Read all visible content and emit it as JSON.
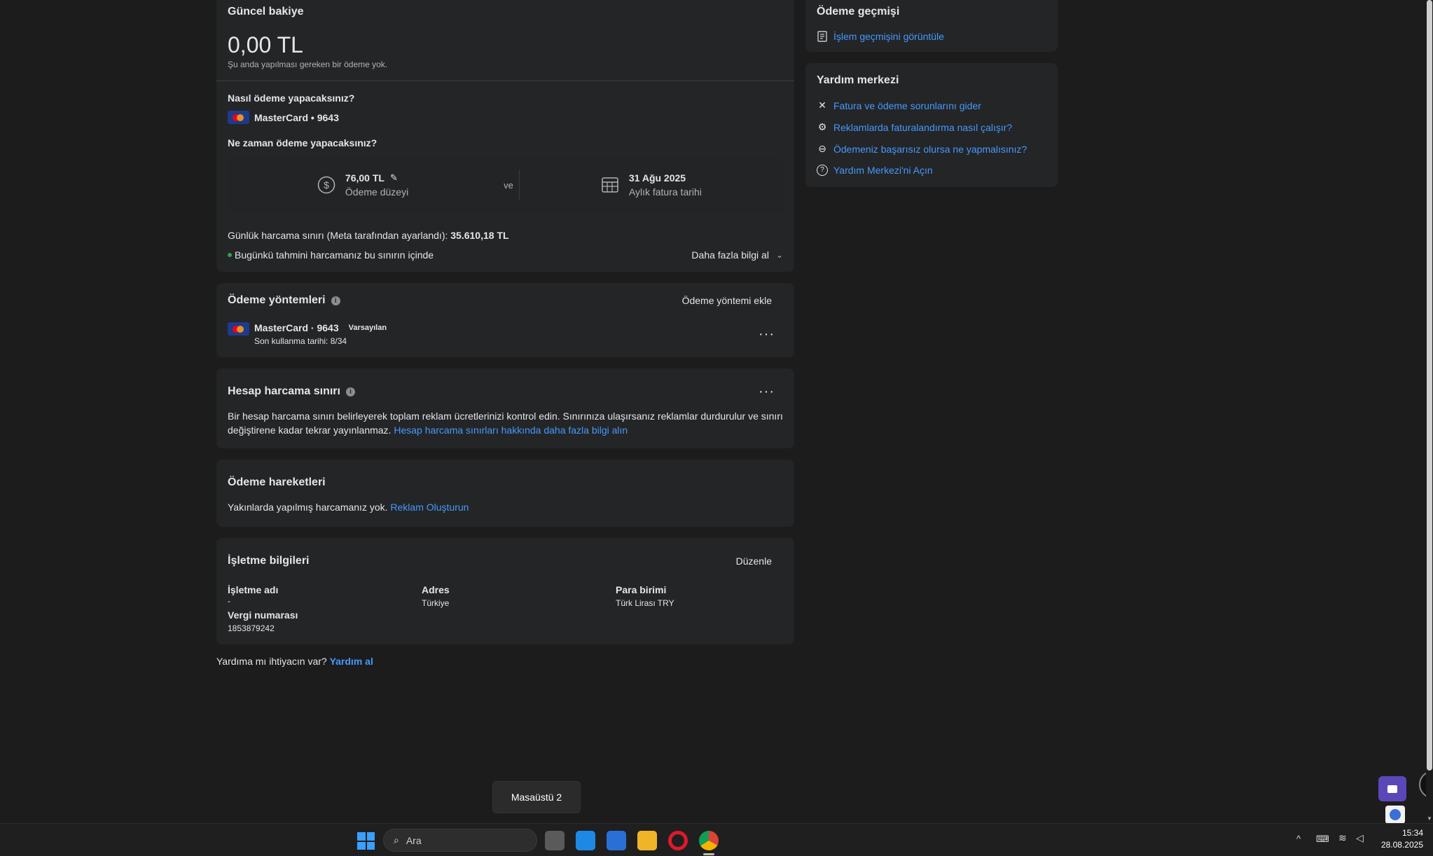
{
  "balance": {
    "title": "Güncel bakiye",
    "amount": "0,00 TL",
    "note": "Şu anda yapılması gereken bir ödeme yok."
  },
  "payment": {
    "how_title": "Nasıl ödeme yapacaksınız?",
    "card": "MasterCard • 9643",
    "when_title": "Ne zaman ödeme yapacaksınız?",
    "threshold_value": "76,00 TL",
    "threshold_label": "Ödeme düzeyi",
    "connector": "ve",
    "date_value": "31 Ağu 2025",
    "date_label": "Aylık fatura tarihi",
    "daily_limit_label": "Günlük harcama sınırı (Meta tarafından ayarlandı):",
    "daily_limit_value": "35.610,18 TL",
    "status": "Bugünkü tahmini harcamanız bu sınırın içinde",
    "more_info": "Daha fazla bilgi al"
  },
  "methods": {
    "title": "Ödeme yöntemleri",
    "add": "Ödeme yöntemi ekle",
    "card": "MasterCard · 9643",
    "badge": "Varsayılan",
    "expiry": "Son kullanma tarihi: 8/34"
  },
  "spending_limit": {
    "title": "Hesap harcama sınırı",
    "body": "Bir hesap harcama sınırı belirleyerek toplam reklam ücretlerinizi kontrol edin. Sınırınıza ulaşırsanız reklamlar durdurulur ve sınırı değiştirene kadar tekrar yayınlanmaz.",
    "link": "Hesap harcama sınırları hakkında daha fazla bilgi alın"
  },
  "activity": {
    "title": "Ödeme hareketleri",
    "body": "Yakınlarda yapılmış harcamanız yok.",
    "link": "Reklam Oluşturun"
  },
  "business": {
    "title": "İşletme bilgileri",
    "edit": "Düzenle",
    "name_label": "İşletme adı",
    "name_value": "-",
    "address_label": "Adres",
    "address_value": "Türkiye",
    "currency_label": "Para birimi",
    "currency_value": "Türk Lirası TRY",
    "tax_label": "Vergi numarası",
    "tax_value": "1853879242"
  },
  "help_footer": {
    "text": "Yardıma mı ihtiyacın var?",
    "link": "Yardım al"
  },
  "history": {
    "title": "Ödeme geçmişi",
    "link": "İşlem geçmişini görüntüle"
  },
  "help_center": {
    "title": "Yardım merkezi",
    "items": [
      "Fatura ve ödeme sorunlarını gider",
      "Reklamlarda faturalandırma nasıl çalışır?",
      "Ödemeniz başarısız olursa ne yapmalısınız?",
      "Yardım Merkezi'ni Açın"
    ]
  },
  "desktop_tooltip": "Masaüstü 2",
  "taskbar": {
    "search_placeholder": "Ara",
    "time": "15:34",
    "date": "28.08.2025"
  },
  "colors": {
    "background": "#1c1c1d",
    "card": "#242526",
    "link": "#4599ff",
    "status_dot": "#31a24c"
  }
}
